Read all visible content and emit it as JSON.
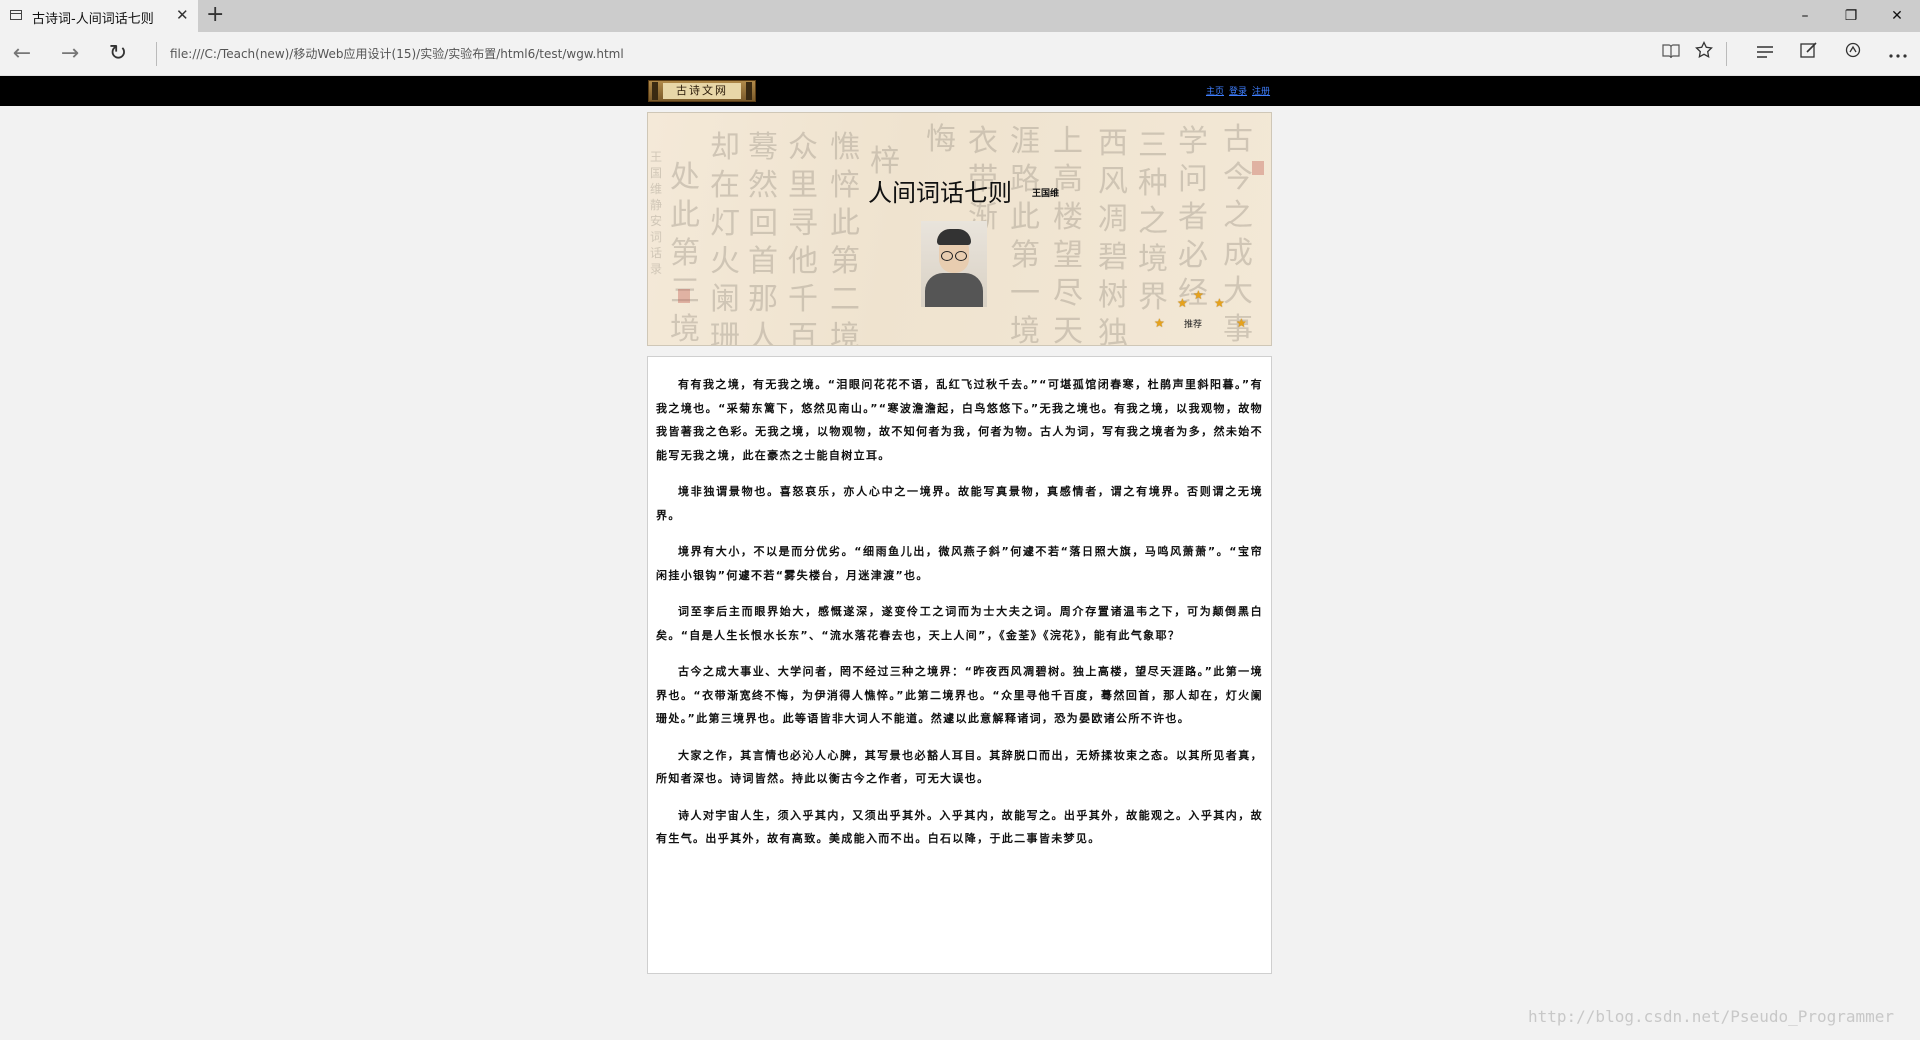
{
  "browser": {
    "tab_title": "古诗词-人间词话七则",
    "tab_close": "✕",
    "new_tab": "+",
    "url": "file:///C:/Teach(new)/移动Web应用设计(15)/实验/实验布置/html6/test/wgw.html",
    "window_controls": {
      "minimize": "–",
      "restore": "❐",
      "close": "✕"
    },
    "nav": {
      "back": "←",
      "forward": "→",
      "refresh": "↻"
    },
    "toolbar_icons": [
      "reading-view-icon",
      "favorite-star-icon",
      "hub-icon",
      "web-note-icon",
      "share-icon",
      "more-icon"
    ]
  },
  "header": {
    "logo_text": "古诗文网",
    "links": [
      "主页",
      "登录",
      "注册"
    ]
  },
  "banner": {
    "title": "人间词话七则",
    "author": "王国维",
    "recommend_label": "推荐",
    "background_calligraphy": [
      "古今之成大事业者",
      "学问者必经",
      "三种之境界",
      "西风凋碧树独",
      "上高楼望尽天",
      "涯路此第一境也",
      "衣带渐",
      "悔",
      "梓",
      "憔悴此第二境也",
      "众里寻他千百度",
      "蓦然回首那人",
      "却在灯火阑珊",
      "处此第三境也",
      "王国维静安词话录"
    ]
  },
  "article": {
    "paragraphs": [
      "有有我之境，有无我之境。“泪眼问花花不语，乱红飞过秋千去。”“可堪孤馆闭春寒，杜鹃声里斜阳暮。”有我之境也。“采菊东篱下，悠然见南山。”“寒波澹澹起，白鸟悠悠下。”无我之境也。有我之境，以我观物，故物我皆著我之色彩。无我之境，以物观物，故不知何者为我，何者为物。古人为词，写有我之境者为多，然未始不能写无我之境，此在豪杰之士能自树立耳。",
      "境非独谓景物也。喜怒哀乐，亦人心中之一境界。故能写真景物，真感情者，谓之有境界。否则谓之无境界。",
      "境界有大小，不以是而分优劣。“细雨鱼儿出，微风燕子斜”何遽不若“落日照大旗，马鸣风萧萧”。“宝帘闲挂小银钩”何遽不若“雾失楼台，月迷津渡”也。",
      "词至李后主而眼界始大，感慨遂深，遂变伶工之词而为士大夫之词。周介存置诸温韦之下，可为颠倒黑白矣。“自是人生长恨水长东”、“流水落花春去也，天上人间”，《金荃》《浣花》，能有此气象耶？",
      "古今之成大事业、大学问者，罔不经过三种之境界：“昨夜西风凋碧树。独上高楼，望尽天涯路。”此第一境界也。“衣带渐宽终不悔，为伊消得人憔悴。”此第二境界也。“众里寻他千百度，蓦然回首，那人却在，灯火阑珊处。”此第三境界也。此等语皆非大词人不能道。然遽以此意解释诸词，恐为晏欧诸公所不许也。",
      "大家之作，其言情也必沁人心脾，其写景也必豁人耳目。其辞脱口而出，无矫揉妆束之态。以其所见者真，所知者深也。诗词皆然。持此以衡古今之作者，可无大误也。",
      "诗人对宇宙人生，须入乎其内，又须出乎其外。入乎其内，故能写之。出乎其外，故能观之。入乎其内，故有生气。出乎其外，故有高致。美成能入而不出。白石以降，于此二事皆未梦见。"
    ]
  },
  "watermark": "http://blog.csdn.net/Pseudo_Programmer",
  "colors": {
    "topbar": "#000000",
    "link": "#3f7fff",
    "star": "#e6a21c"
  }
}
